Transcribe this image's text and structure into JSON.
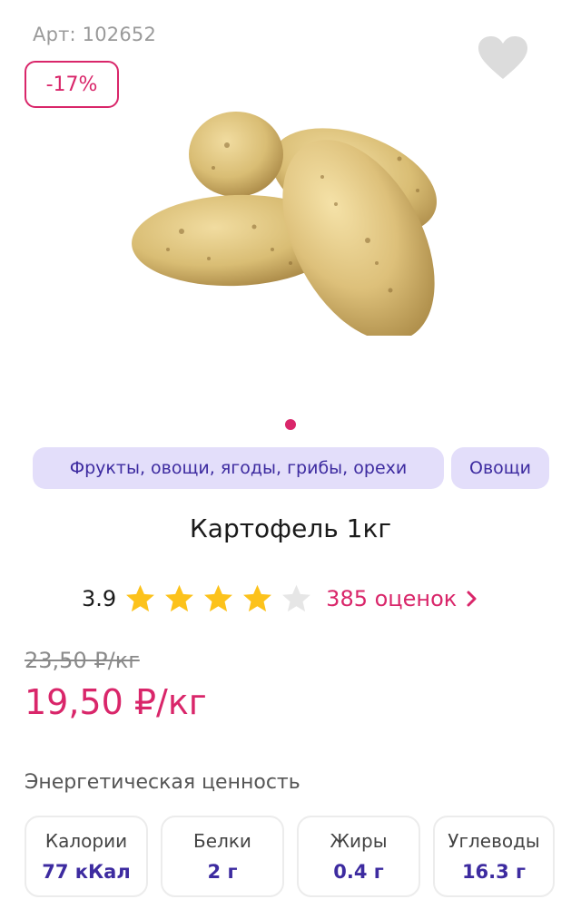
{
  "article": "Арт: 102652",
  "discount_badge": "-17%",
  "favorite_icon": "heart-icon",
  "gallery": {
    "dots_count": 1,
    "active_color": "#d9266a"
  },
  "tags": [
    {
      "label": "Фрукты, овощи, ягоды, грибы, орехи"
    },
    {
      "label": "Овощи"
    }
  ],
  "product": {
    "title": "Картофель 1кг",
    "rating": "3.9",
    "stars_filled": 4,
    "stars_total": 5,
    "reviews_label": "385 оценок",
    "old_price": "23,50 ₽/кг",
    "new_price": "19,50 ₽/кг"
  },
  "energy": {
    "title": "Энергетическая ценность",
    "items": [
      {
        "label": "Калории",
        "value": "77 кКал"
      },
      {
        "label": "Белки",
        "value": "2 г"
      },
      {
        "label": "Жиры",
        "value": "0.4 г"
      },
      {
        "label": "Углеводы",
        "value": "16.3 г"
      }
    ]
  },
  "colors": {
    "accent": "#d9266a",
    "tag_bg": "#e3defa",
    "tag_text": "#3d2ba0",
    "star_filled": "#fcc21b",
    "star_empty": "#e6e6e6"
  }
}
